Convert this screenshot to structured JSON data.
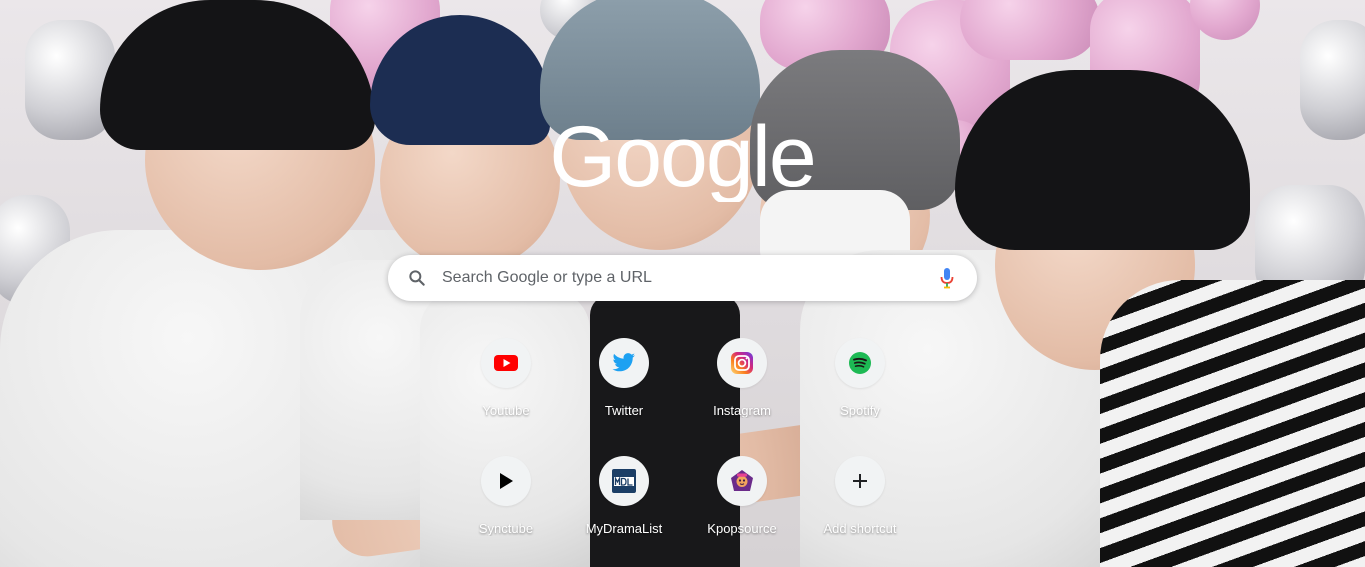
{
  "logo": {
    "text": "Google",
    "color": "#ffffff"
  },
  "search": {
    "placeholder": "Search Google or type a URL",
    "search_icon": "search-icon",
    "mic_icon": "mic-icon"
  },
  "shortcuts": [
    {
      "label": "Youtube",
      "icon": "youtube-icon",
      "color": "#ff0000"
    },
    {
      "label": "Twitter",
      "icon": "twitter-icon",
      "color": "#1da1f2"
    },
    {
      "label": "Instagram",
      "icon": "instagram-icon",
      "color": "#c13584"
    },
    {
      "label": "Spotify",
      "icon": "spotify-icon",
      "color": "#1db954"
    },
    {
      "label": "Synctube",
      "icon": "play-icon",
      "color": "#000000"
    },
    {
      "label": "MyDramaList",
      "icon": "mydramalist-icon",
      "color": "#1b3e66"
    },
    {
      "label": "Kpopsource",
      "icon": "kpopsource-icon",
      "color": "#6b2b8a"
    },
    {
      "label": "Add shortcut",
      "icon": "plus-icon",
      "color": "#202124"
    }
  ],
  "colors": {
    "tile_background": "#f1f3f4",
    "searchbox_background": "#ffffff",
    "placeholder_text": "#5f6368"
  }
}
